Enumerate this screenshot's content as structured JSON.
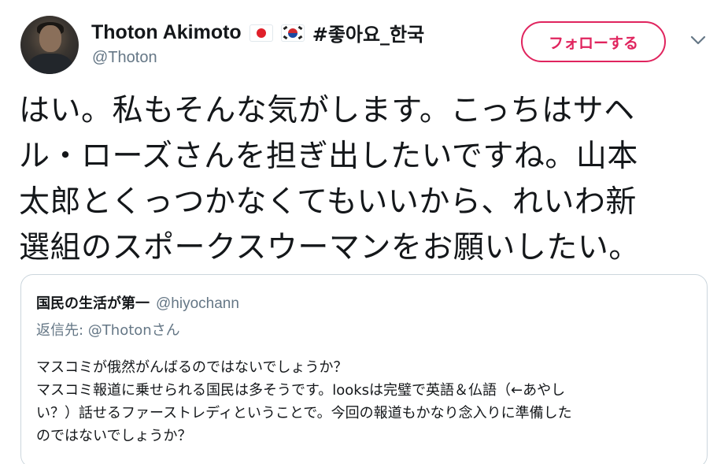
{
  "author": {
    "display_name": "Thoton Akimoto",
    "flags": [
      "japan-flag-icon",
      "south-korea-flag-icon"
    ],
    "hashtag": "#좋아요_한국",
    "handle": "@Thoton"
  },
  "follow_button": {
    "label": "フォローする"
  },
  "menu": {
    "icon": "chevron-down-icon"
  },
  "tweet": {
    "lines": [
      "はい。私もそんな気がします。こっちはサヘ",
      "ル・ローズさんを担ぎ出したいですね。山本",
      "太郎とくっつかなくてもいいから、れいわ新",
      "選組のスポークスウーマンをお願いしたい。"
    ]
  },
  "quoted_tweet": {
    "display_name": "国民の生活が第一",
    "handle": "@hiyochann",
    "reply_prefix": "返信先: @Thotonさん",
    "body_lines": [
      "マスコミが俄然がんばるのではないでしょうか？",
      "マスコミ報道に乗せられる国民は多そうです。looksは完璧で英語＆仏語（←あやし",
      "い？）話せるファーストレディということで。今回の報道もかなり念入りに準備した",
      "のではないでしょうか？"
    ]
  },
  "colors": {
    "accent": "#e0245e",
    "muted": "#657786",
    "border": "#ccd6dd",
    "text": "#14171a"
  }
}
